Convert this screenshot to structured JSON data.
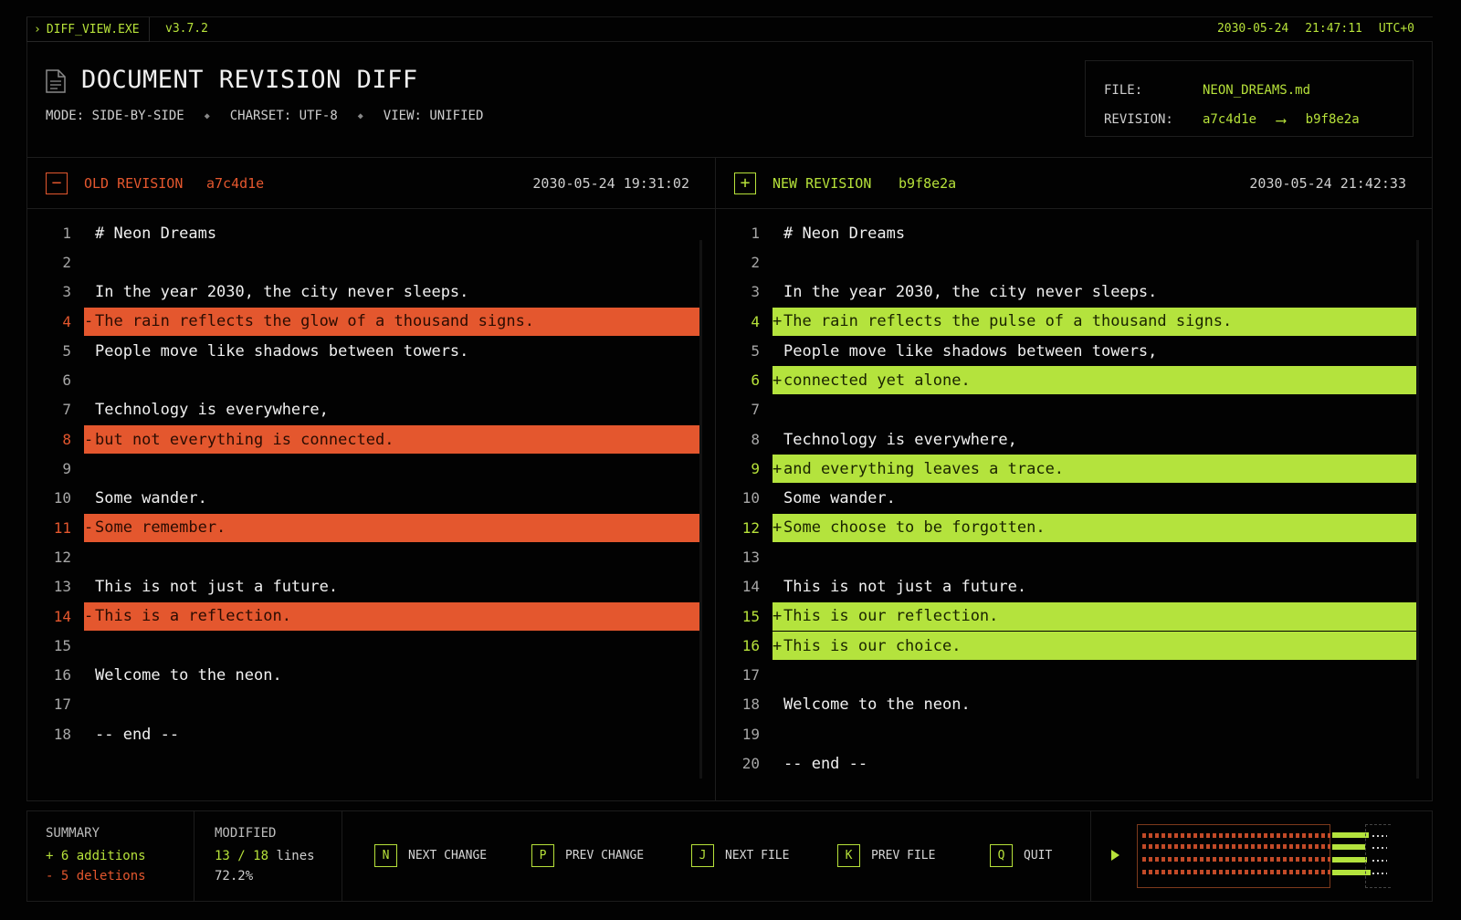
{
  "topbar": {
    "app_name": "DIFF_VIEW.EXE",
    "version": "v3.7.2",
    "date": "2030-05-24",
    "time": "21:47:11",
    "tz": "UTC+0"
  },
  "header": {
    "title": "DOCUMENT REVISION DIFF",
    "meta": [
      "MODE: SIDE-BY-SIDE",
      "CHARSET: UTF-8",
      "VIEW: UNIFIED"
    ],
    "meta_sep": "◆",
    "file_label": "FILE:",
    "file_value": "NEON_DREAMS.md",
    "revision_label": "REVISION:",
    "revision_from": "a7c4d1e",
    "revision_arrow": "⟶",
    "revision_to": "b9f8e2a"
  },
  "old_panel": {
    "icon": "−",
    "label": "OLD REVISION",
    "hash": "a7c4d1e",
    "timestamp": "2030-05-24  19:31:02",
    "lines": [
      {
        "n": "1",
        "text": "# Neon Dreams",
        "type": "plain"
      },
      {
        "n": "2",
        "text": "",
        "type": "plain"
      },
      {
        "n": "3",
        "text": "In the year 2030, the city never sleeps.",
        "type": "plain"
      },
      {
        "n": "4",
        "text": "The rain reflects the glow of a thousand signs.",
        "type": "del"
      },
      {
        "n": "5",
        "text": "People move like shadows between towers.",
        "type": "plain"
      },
      {
        "n": "6",
        "text": "",
        "type": "plain"
      },
      {
        "n": "7",
        "text": "Technology is everywhere,",
        "type": "plain"
      },
      {
        "n": "8",
        "text": "but not everything is connected.",
        "type": "del"
      },
      {
        "n": "9",
        "text": "",
        "type": "plain"
      },
      {
        "n": "10",
        "text": "Some wander.",
        "type": "plain"
      },
      {
        "n": "11",
        "text": "Some remember.",
        "type": "del"
      },
      {
        "n": "12",
        "text": "",
        "type": "plain"
      },
      {
        "n": "13",
        "text": "This is not just a future.",
        "type": "plain"
      },
      {
        "n": "14",
        "text": "This is a reflection.",
        "type": "del"
      },
      {
        "n": "15",
        "text": "",
        "type": "plain"
      },
      {
        "n": "16",
        "text": "Welcome to the neon.",
        "type": "plain"
      },
      {
        "n": "17",
        "text": "",
        "type": "plain"
      },
      {
        "n": "18",
        "text": "-- end --",
        "type": "plain"
      }
    ]
  },
  "new_panel": {
    "icon": "+",
    "label": "NEW REVISION",
    "hash": "b9f8e2a",
    "timestamp": "2030-05-24  21:42:33",
    "lines": [
      {
        "n": "1",
        "text": "# Neon Dreams",
        "type": "plain"
      },
      {
        "n": "2",
        "text": "",
        "type": "plain"
      },
      {
        "n": "3",
        "text": "In the year 2030, the city never sleeps.",
        "type": "plain"
      },
      {
        "n": "4",
        "text": "The rain reflects the pulse of a thousand signs.",
        "type": "add"
      },
      {
        "n": "5",
        "text": "People move like shadows between towers,",
        "type": "plain"
      },
      {
        "n": "6",
        "text": "connected yet alone.",
        "type": "add"
      },
      {
        "n": "7",
        "text": "",
        "type": "plain"
      },
      {
        "n": "8",
        "text": "Technology is everywhere,",
        "type": "plain"
      },
      {
        "n": "9",
        "text": "and everything leaves a trace.",
        "type": "add"
      },
      {
        "n": "10",
        "text": "Some wander.",
        "type": "plain"
      },
      {
        "n": "12",
        "text": "Some choose to be forgotten.",
        "type": "add"
      },
      {
        "n": "13",
        "text": "",
        "type": "plain"
      },
      {
        "n": "14",
        "text": "This is not just a future.",
        "type": "plain"
      },
      {
        "n": "15",
        "text": "This is our reflection.",
        "type": "add"
      },
      {
        "n": "16",
        "text": "This is our choice.",
        "type": "add"
      },
      {
        "n": "17",
        "text": "",
        "type": "plain"
      },
      {
        "n": "18",
        "text": "Welcome to the neon.",
        "type": "plain"
      },
      {
        "n": "19",
        "text": "",
        "type": "plain"
      },
      {
        "n": "20",
        "text": "-- end --",
        "type": "plain"
      }
    ]
  },
  "summary": {
    "heading": "SUMMARY",
    "additions": "+ 6 additions",
    "deletions": "- 5 deletions"
  },
  "modified": {
    "heading": "MODIFIED",
    "count": "13 / 18",
    "unit": "lines",
    "percent": "72.2%"
  },
  "keys": [
    {
      "key": "N",
      "label": "NEXT CHANGE"
    },
    {
      "key": "P",
      "label": "PREV CHANGE"
    },
    {
      "key": "J",
      "label": "NEXT FILE"
    },
    {
      "key": "K",
      "label": "PREV FILE"
    },
    {
      "key": "Q",
      "label": "QUIT"
    }
  ],
  "colors": {
    "accent_green": "#b7e23a",
    "accent_orange": "#e4572e",
    "background": "#020202"
  }
}
